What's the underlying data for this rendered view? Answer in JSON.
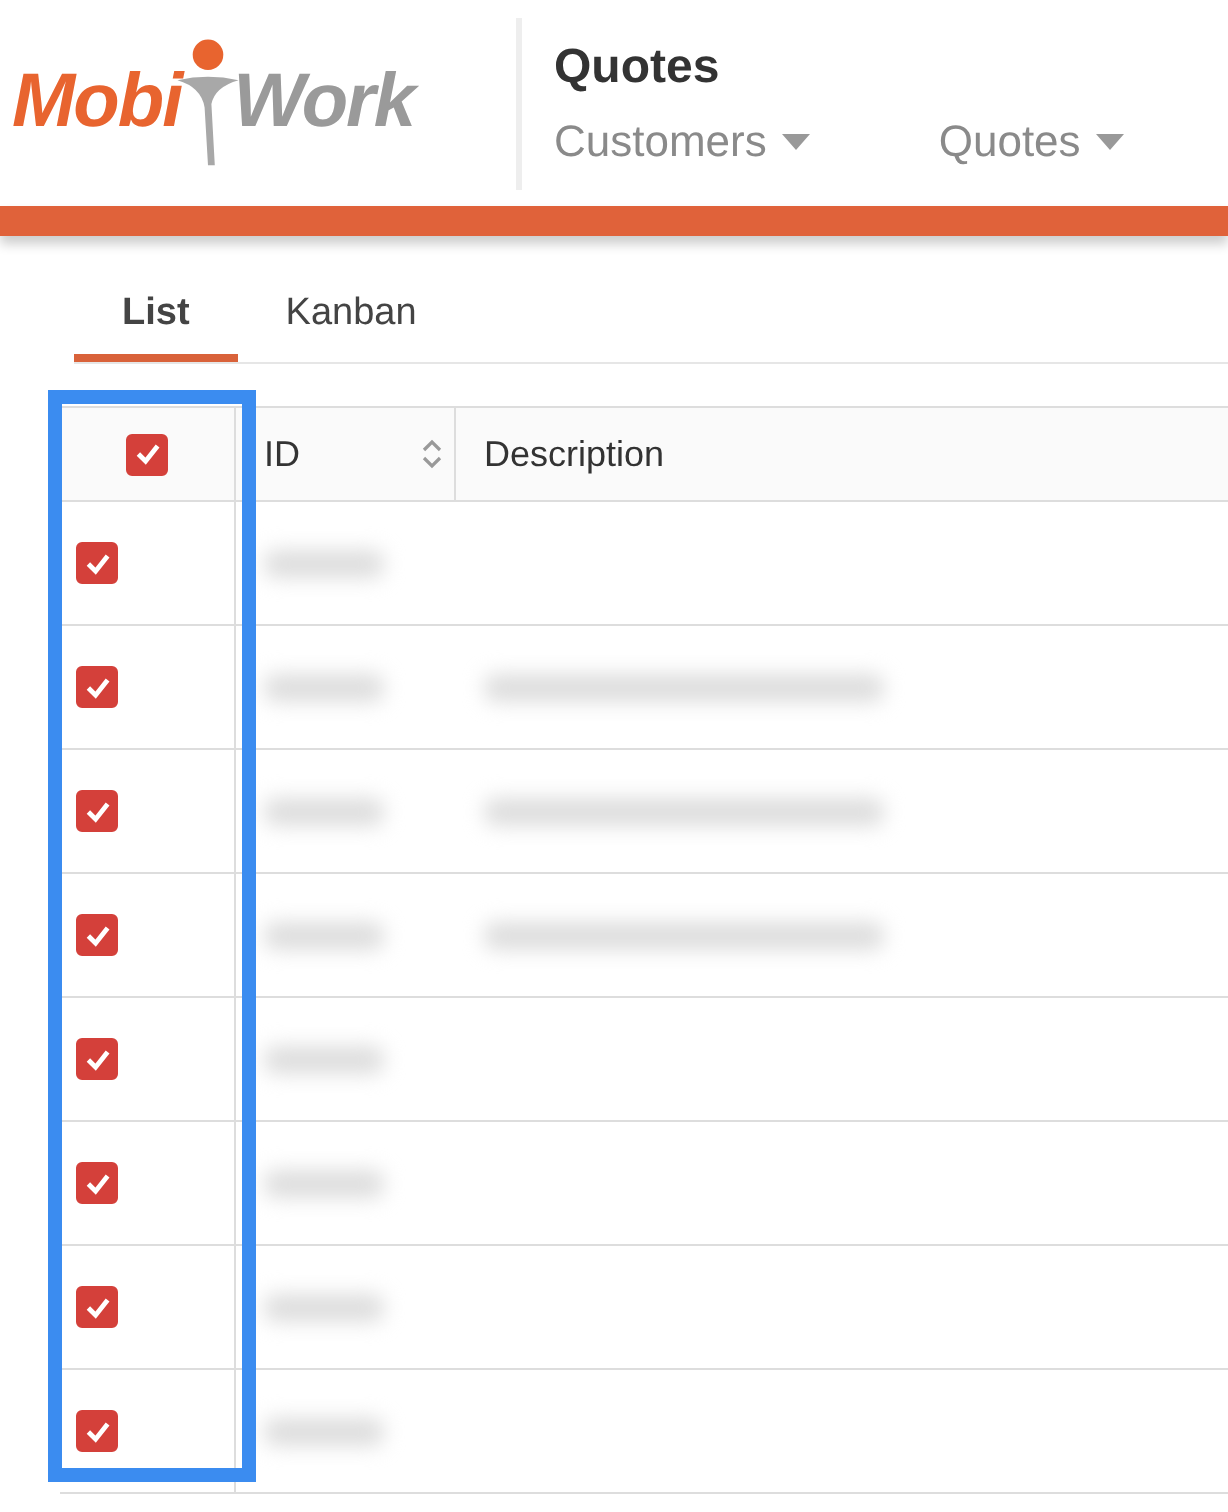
{
  "logo": {
    "left": "Mobi",
    "right": "Work"
  },
  "page_title": "Quotes",
  "nav": [
    {
      "label": "Customers"
    },
    {
      "label": "Quotes"
    }
  ],
  "tabs": [
    {
      "label": "List",
      "selected": true
    },
    {
      "label": "Kanban",
      "selected": false
    }
  ],
  "table": {
    "select_all": {
      "checked": true
    },
    "columns": [
      {
        "label": "ID",
        "sortable": true
      },
      {
        "label": "Description",
        "sortable": false
      }
    ],
    "rows": [
      {
        "checked": true,
        "description_blurred": false
      },
      {
        "checked": true,
        "description_blurred": true
      },
      {
        "checked": true,
        "description_blurred": true
      },
      {
        "checked": true,
        "description_blurred": true
      },
      {
        "checked": true,
        "description_blurred": false
      },
      {
        "checked": true,
        "description_blurred": false
      },
      {
        "checked": true,
        "description_blurred": false
      },
      {
        "checked": true,
        "description_blurred": false
      }
    ]
  },
  "highlight": {
    "on": true
  }
}
